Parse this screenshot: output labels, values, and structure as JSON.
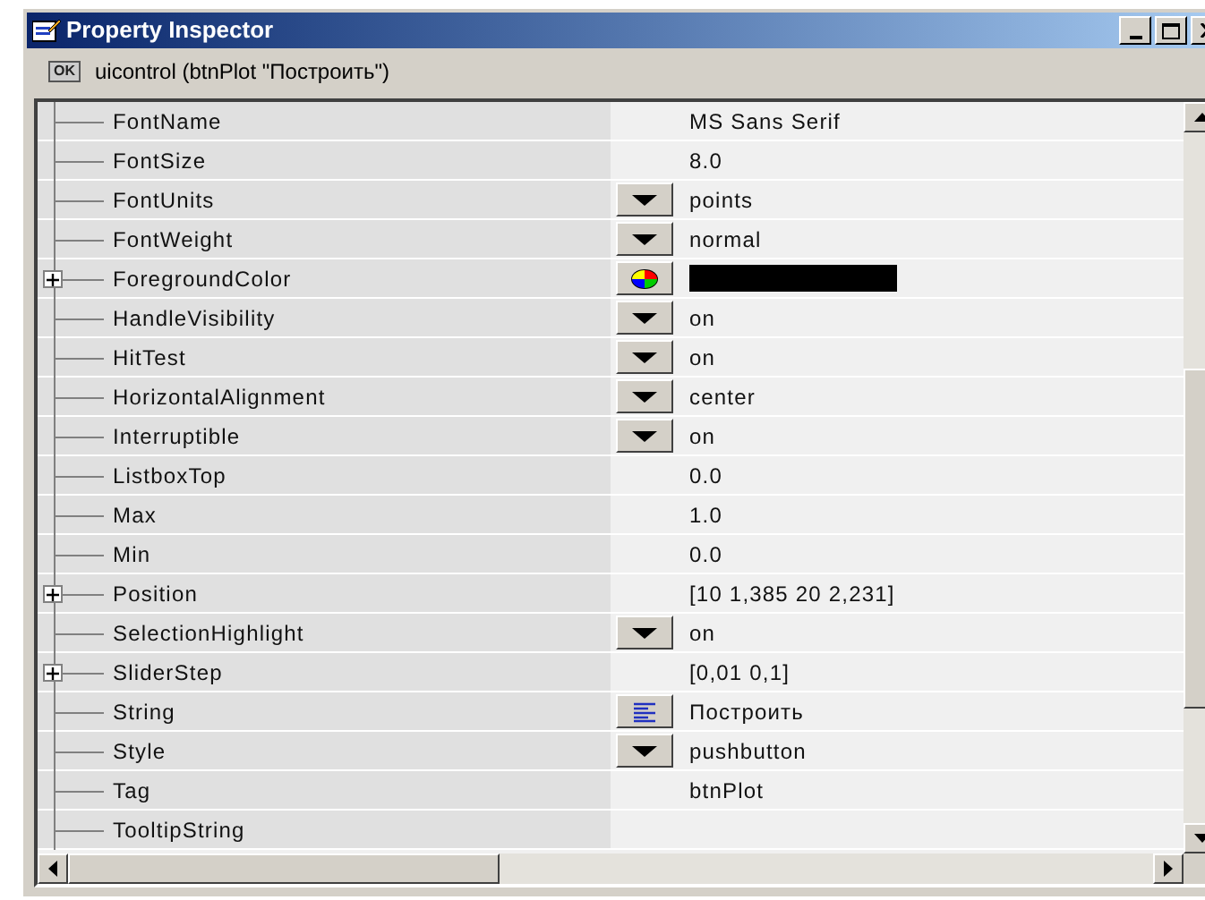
{
  "window": {
    "title": "Property Inspector"
  },
  "object": {
    "badge": "OK",
    "label": "uicontrol (btnPlot \"Построить\")"
  },
  "properties": [
    {
      "name": "FontName",
      "expandable": false,
      "kind": "text",
      "value": "MS Sans Serif"
    },
    {
      "name": "FontSize",
      "expandable": false,
      "kind": "text",
      "value": "8.0"
    },
    {
      "name": "FontUnits",
      "expandable": false,
      "kind": "dropdown",
      "value": "points"
    },
    {
      "name": "FontWeight",
      "expandable": false,
      "kind": "dropdown",
      "value": "normal"
    },
    {
      "name": "ForegroundColor",
      "expandable": true,
      "kind": "color",
      "color": "#000000"
    },
    {
      "name": "HandleVisibility",
      "expandable": false,
      "kind": "dropdown",
      "value": "on"
    },
    {
      "name": "HitTest",
      "expandable": false,
      "kind": "dropdown",
      "value": "on"
    },
    {
      "name": "HorizontalAlignment",
      "expandable": false,
      "kind": "dropdown",
      "value": "center"
    },
    {
      "name": "Interruptible",
      "expandable": false,
      "kind": "dropdown",
      "value": "on"
    },
    {
      "name": "ListboxTop",
      "expandable": false,
      "kind": "text",
      "value": "0.0"
    },
    {
      "name": "Max",
      "expandable": false,
      "kind": "text",
      "value": "1.0"
    },
    {
      "name": "Min",
      "expandable": false,
      "kind": "text",
      "value": "0.0"
    },
    {
      "name": "Position",
      "expandable": true,
      "kind": "text",
      "value": "[10 1,385 20 2,231]"
    },
    {
      "name": "SelectionHighlight",
      "expandable": false,
      "kind": "dropdown",
      "value": "on"
    },
    {
      "name": "SliderStep",
      "expandable": true,
      "kind": "text",
      "value": "[0,01 0,1]"
    },
    {
      "name": "String",
      "expandable": false,
      "kind": "string",
      "value": "Построить"
    },
    {
      "name": "Style",
      "expandable": false,
      "kind": "dropdown",
      "value": "pushbutton"
    },
    {
      "name": "Tag",
      "expandable": false,
      "kind": "text",
      "value": "btnPlot"
    },
    {
      "name": "TooltipString",
      "expandable": false,
      "kind": "text"
    }
  ]
}
